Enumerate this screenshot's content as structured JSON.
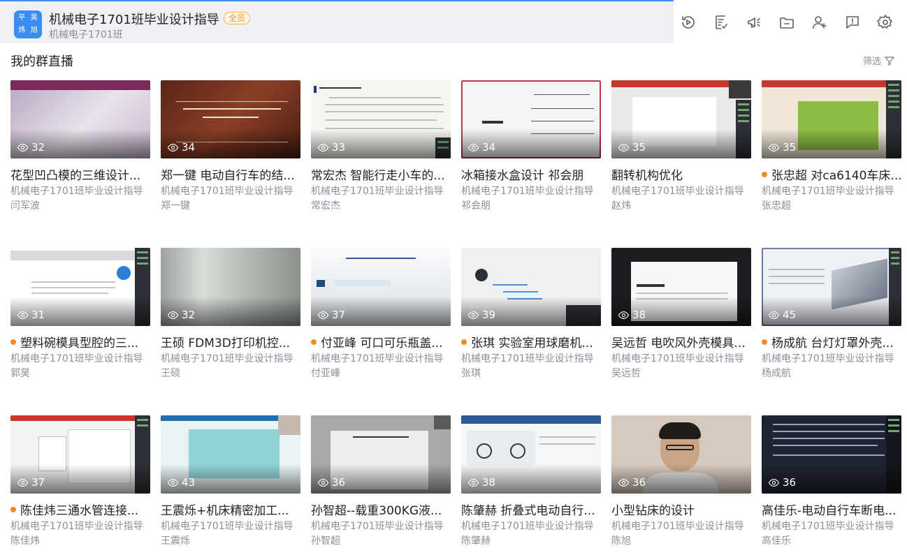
{
  "header": {
    "avatar_chars": [
      "平",
      "昊",
      "炜",
      "旭"
    ],
    "group_name": "机械电子1701班毕业设计指导",
    "member_badge": "全员",
    "group_subtitle": "机械电子1701班",
    "toolbar_icons": [
      "history-icon",
      "checklist-icon",
      "announcement-icon",
      "folder-icon",
      "add-member-icon",
      "report-icon",
      "settings-icon"
    ]
  },
  "section": {
    "title": "我的群直播",
    "filter_label": "筛选"
  },
  "cards": [
    {
      "title": "花型凹凸模的三维设计...",
      "group": "机械电子1701班毕业设计指导",
      "author": "闫军波",
      "views": "32",
      "live": false,
      "theme": "purple"
    },
    {
      "title": "郑一键 电动自行车的结...",
      "group": "机械电子1701班毕业设计指导",
      "author": "郑一键",
      "views": "34",
      "live": false,
      "theme": "wood"
    },
    {
      "title": "常宏杰 智能行走小车的...",
      "group": "机械电子1701班毕业设计指导",
      "author": "常宏杰",
      "views": "33",
      "live": false,
      "theme": "doc"
    },
    {
      "title": "冰箱接水盒设计 祁会朋",
      "group": "机械电子1701班毕业设计指导",
      "author": "祁会朋",
      "views": "34",
      "live": false,
      "theme": "toc"
    },
    {
      "title": "翻转机构优化",
      "group": "机械电子1701班毕业设计指导",
      "author": "赵炜",
      "views": "35",
      "live": false,
      "theme": "ppt"
    },
    {
      "title": "张忠超 对ca6140车床...",
      "group": "机械电子1701班毕业设计指导",
      "author": "张忠超",
      "views": "35",
      "live": true,
      "theme": "green"
    },
    {
      "title": "塑料碗模具型腔的三...",
      "group": "机械电子1701班毕业设计指导",
      "author": "郭昊",
      "views": "31",
      "live": true,
      "theme": "blue-title"
    },
    {
      "title": "王硕 FDM3D打印机控...",
      "group": "机械电子1701班毕业设计指导",
      "author": "王硕",
      "views": "32",
      "live": false,
      "theme": "blurry"
    },
    {
      "title": "付亚峰 可口可乐瓶盖...",
      "group": "机械电子1701班毕业设计指导",
      "author": "付亚峰",
      "views": "37",
      "live": true,
      "theme": "contents"
    },
    {
      "title": "张琪 实验室用球磨机...",
      "group": "机械电子1701班毕业设计指导",
      "author": "张琪",
      "views": "39",
      "live": true,
      "theme": "white-list"
    },
    {
      "title": "吴远哲 电吹风外壳模具...",
      "group": "机械电子1701班毕业设计指导",
      "author": "吴远哲",
      "views": "38",
      "live": false,
      "theme": "dark"
    },
    {
      "title": "杨成航 台灯灯罩外壳...",
      "group": "机械电子1701班毕业设计指导",
      "author": "杨成航",
      "views": "45",
      "live": true,
      "theme": "laptop"
    },
    {
      "title": "陈佳炜三通水管连接...",
      "group": "机械电子1701班毕业设计指导",
      "author": "陈佳炜",
      "views": "37",
      "live": true,
      "theme": "busy"
    },
    {
      "title": "王震烁+机床精密加工...",
      "group": "机械电子1701班毕业设计指导",
      "author": "王震烁",
      "views": "43",
      "live": false,
      "theme": "teal"
    },
    {
      "title": "孙智超--载重300KG液...",
      "group": "机械电子1701班毕业设计指导",
      "author": "孙智超",
      "views": "36",
      "live": false,
      "theme": "gray-ppt"
    },
    {
      "title": "陈肇赫 折叠式电动自行...",
      "group": "机械电子1701班毕业设计指导",
      "author": "陈肇赫",
      "views": "38",
      "live": false,
      "theme": "bike"
    },
    {
      "title": "小型钻床的设计",
      "group": "机械电子1701班毕业设计指导",
      "author": "陈旭",
      "views": "36",
      "live": false,
      "theme": "face"
    },
    {
      "title": "高佳乐-电动自行车断电...",
      "group": "机械电子1701班毕业设计指导",
      "author": "高佳乐",
      "views": "36",
      "live": false,
      "theme": "navy"
    }
  ]
}
